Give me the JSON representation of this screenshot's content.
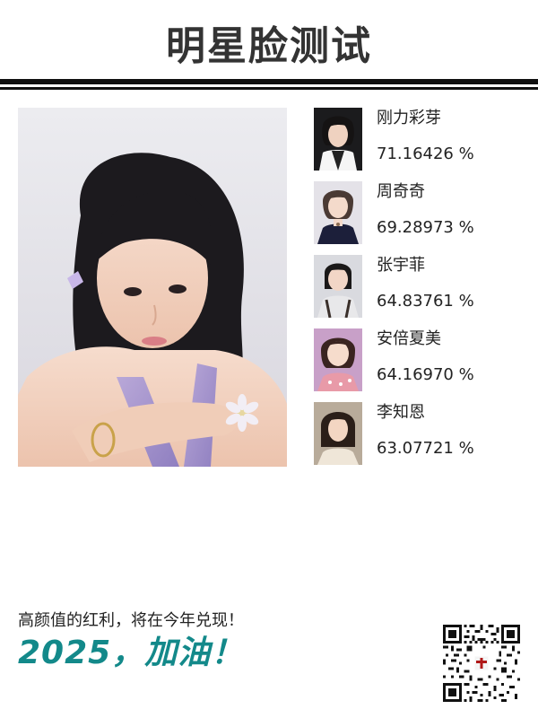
{
  "header": {
    "title": "明星脸测试"
  },
  "main_photo": {
    "description_icon": "portrait-photo"
  },
  "matches": [
    {
      "name": "刚力彩芽",
      "score": "71.16426 %",
      "thumb_icon": "celebrity-photo"
    },
    {
      "name": "周奇奇",
      "score": "69.28973 %",
      "thumb_icon": "celebrity-photo"
    },
    {
      "name": "张宇菲",
      "score": "64.83761 %",
      "thumb_icon": "celebrity-photo"
    },
    {
      "name": "安倍夏美",
      "score": "64.16970 %",
      "thumb_icon": "celebrity-photo"
    },
    {
      "name": "李知恩",
      "score": "63.07721 %",
      "thumb_icon": "celebrity-photo"
    }
  ],
  "footer": {
    "slogan": "高颜值的红利，将在今年兑现！",
    "cheer": "2025，加油！",
    "qr_icon": "qr-code"
  },
  "colors": {
    "accent": "#13898a",
    "title": "#333333",
    "rule": "#111111"
  }
}
